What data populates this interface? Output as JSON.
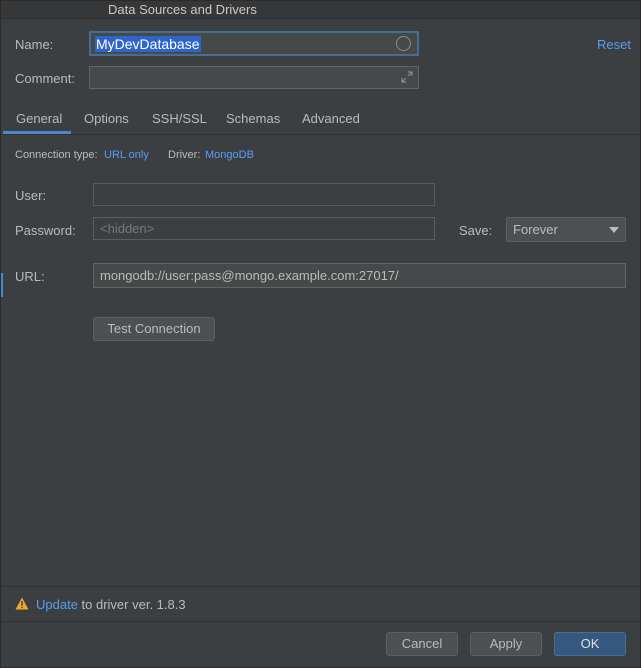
{
  "window": {
    "title": "Data Sources and Drivers"
  },
  "form": {
    "name_label": "Name:",
    "name_value": "MyDevDatabase",
    "reset_label": "Reset",
    "comment_label": "Comment:",
    "comment_value": ""
  },
  "tabs": [
    {
      "label": "General",
      "active": true
    },
    {
      "label": "Options"
    },
    {
      "label": "SSH/SSL"
    },
    {
      "label": "Schemas"
    },
    {
      "label": "Advanced"
    }
  ],
  "general": {
    "connection_type_label": "Connection type:",
    "connection_type_value": "URL only",
    "driver_label": "Driver:",
    "driver_value": "MongoDB",
    "user_label": "User:",
    "user_value": "",
    "password_label": "Password:",
    "password_placeholder": "<hidden>",
    "save_label": "Save:",
    "save_value": "Forever",
    "url_label": "URL:",
    "url_value": "mongodb://user:pass@mongo.example.com:27017/",
    "test_connection_label": "Test Connection"
  },
  "footer": {
    "update_link": "Update",
    "update_text": " to driver ver. 1.8.3",
    "cancel_label": "Cancel",
    "apply_label": "Apply",
    "ok_label": "OK"
  },
  "colors": {
    "background": "#3c3f41",
    "link": "#589df6",
    "selection": "#2f65ca",
    "primary_button": "#365880",
    "warning": "#f0a732"
  }
}
